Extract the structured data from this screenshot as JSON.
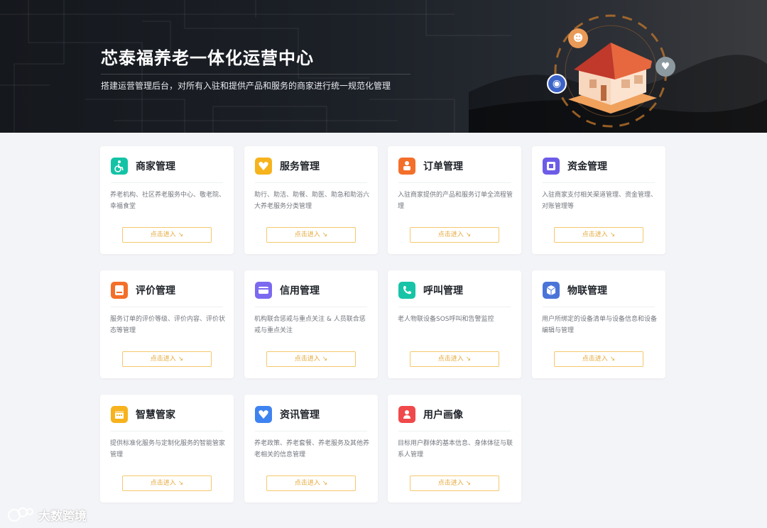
{
  "banner": {
    "title": "芯泰福养老一体化运营中心",
    "subtitle": "搭建运营管理后台，对所有入驻和提供产品和服务的商家进行统一规范化管理"
  },
  "cards": [
    {
      "title": "商家管理",
      "desc": "养老机构、社区养老服务中心、敬老院、幸福食堂",
      "button": "点击进入 ↘",
      "icon": "wheelchair-icon",
      "color": "#14c3a6"
    },
    {
      "title": "服务管理",
      "desc": "助行、助洁、助餐、助医、助急和助浴六大养老服务分类管理",
      "button": "点击进入 ↘",
      "icon": "heart-diamond-icon",
      "color": "#f6b31d"
    },
    {
      "title": "订单管理",
      "desc": "入驻商家提供的产品和服务订单全流程管理",
      "button": "点击进入 ↘",
      "icon": "order-person-icon",
      "color": "#f36f2a"
    },
    {
      "title": "资金管理",
      "desc": "入驻商家支付相关渠道管理、资金管理、对账管理等",
      "button": "点击进入 ↘",
      "icon": "square-fund-icon",
      "color": "#6d5ce8"
    },
    {
      "title": "评价管理",
      "desc": "服务订单的评价等级、评价内容、评价状态等管理",
      "button": "点击进入 ↘",
      "icon": "review-icon",
      "color": "#f36f2a"
    },
    {
      "title": "信用管理",
      "desc": "机构联合惩戒与重点关注 & 人员联合惩戒与重点关注",
      "button": "点击进入 ↘",
      "icon": "credit-card-icon",
      "color": "#7b6af0"
    },
    {
      "title": "呼叫管理",
      "desc": "老人物联设备SOS呼叫和告警监控",
      "button": "点击进入 ↘",
      "icon": "phone-icon",
      "color": "#18c4a7"
    },
    {
      "title": "物联管理",
      "desc": "用户所绑定的设备清单与设备信息和设备编辑与管理",
      "button": "点击进入 ↘",
      "icon": "cube-icon",
      "color": "#4a74d8"
    },
    {
      "title": "智慧管家",
      "desc": "提供标准化服务与定制化服务的智能管家管理",
      "button": "点击进入 ↘",
      "icon": "calendar-icon",
      "color": "#f6b31d"
    },
    {
      "title": "资讯管理",
      "desc": "养老政策、养老套餐、养老服务及其他养老相关的信息管理",
      "button": "点击进入 ↘",
      "icon": "info-heart-icon",
      "color": "#3f83f0"
    },
    {
      "title": "用户画像",
      "desc": "目标用户群体的基本信息、身体体征与联系人管理",
      "button": "点击进入 ↘",
      "icon": "user-portrait-icon",
      "color": "#f0494b"
    }
  ],
  "watermark": "大数跨境"
}
